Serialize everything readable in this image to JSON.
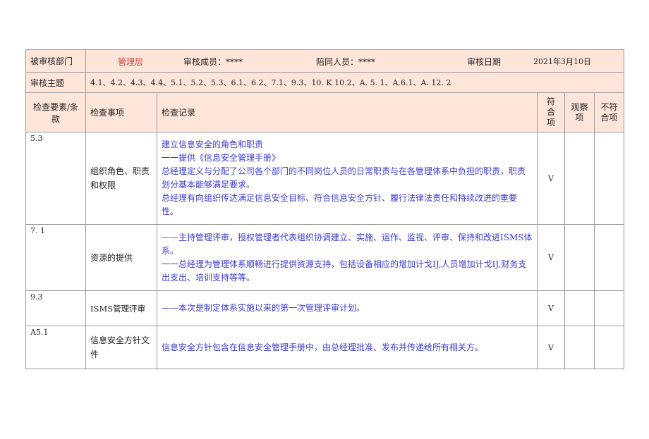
{
  "header": {
    "dept_label": "被审核部门",
    "dept_value": "管理层",
    "auditor_label": "审核成员：****",
    "escort_label": "陪同人员：****",
    "date_label": "审核日期",
    "date_value": "2021年3月10日"
  },
  "topic": {
    "label": "审核主题",
    "value": "4.1、4.2、4.3、4.4、5.1、5.2、5.3、6.1、6.2、7.1、9.3、10. K 10.2、A. 5. 1、A.6.1、A. 12. 2"
  },
  "columns": {
    "clause": "检查要素/条款",
    "item": "检查事项",
    "record": "检查记录",
    "conform": "符合项",
    "observe": "观察项",
    "nonconform": "不符合项"
  },
  "rows": [
    {
      "clause": "5.3",
      "item": "组织角色、职责和权限",
      "record": [
        "建立信息安全的角色和职责",
        "一一提供《信息安全管理手册》",
        "总经理定义与分配了公司各个部门的不同岗位人员的日常职责与在各管理体系中负担的职责，职责划分基本能够满足要求。",
        "总经理有向组织传达满足信息安全目标、符合信息安全方针、履行法律法责任和持续改进的重要性。"
      ],
      "conform": "V"
    },
    {
      "clause": "7. 1",
      "item": "资源的提供",
      "record": [
        "——主持管理评审，授权管理者代表组织协调建立、实施、运作、监视、评审、保持和改进ISMS体系。",
        "一一总经理为管理体系顺畅进行提供资源支持，包括设备相应的增加计戈IJ,人员增加计戈IJ,财务支出支出、培训支持等等。"
      ],
      "conform": "V"
    },
    {
      "clause": "9.3",
      "item": "ISMS管理评审",
      "record": [
        "——本次是制定体系实施以来的第一次管理评审计划。"
      ],
      "conform": "V"
    },
    {
      "clause": "A5.1",
      "item": "信息安全方针文件",
      "record": [
        "信息安全方针包含在信息安全管理手册中，由总经理批准、发布并传递给所有相关方。"
      ],
      "conform": "V"
    }
  ]
}
